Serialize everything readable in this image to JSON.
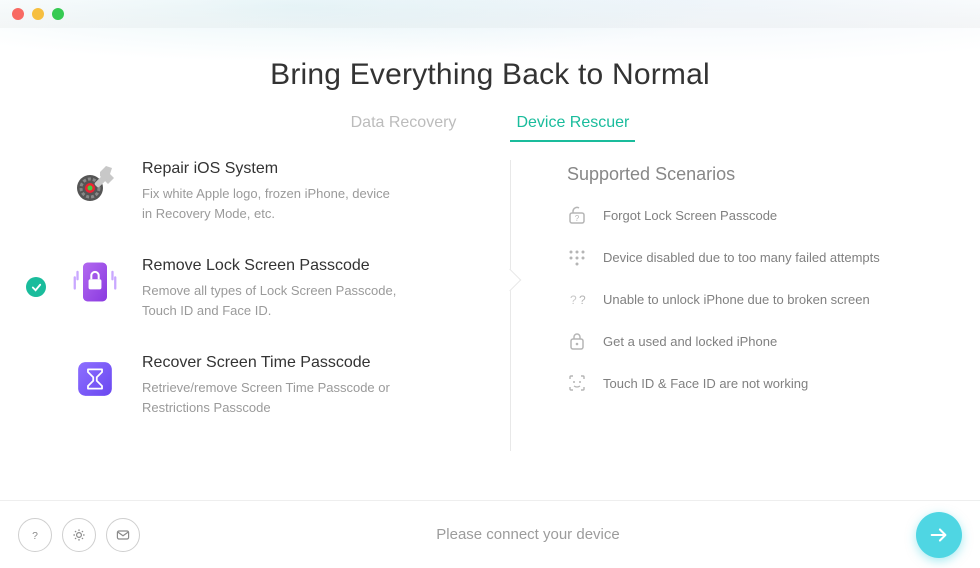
{
  "title": "Bring Everything Back to Normal",
  "tabs": {
    "data_recovery": "Data Recovery",
    "device_rescuer": "Device Rescuer"
  },
  "options": {
    "repair": {
      "title": "Repair iOS System",
      "desc": "Fix white Apple logo, frozen iPhone, device in Recovery Mode, etc."
    },
    "remove": {
      "title": "Remove Lock Screen Passcode",
      "desc": "Remove all types of Lock Screen Passcode, Touch ID and Face ID."
    },
    "recover": {
      "title": "Recover Screen Time Passcode",
      "desc": "Retrieve/remove Screen Time Passcode or Restrictions Passcode"
    }
  },
  "supported": {
    "heading": "Supported Scenarios",
    "items": [
      "Forgot Lock Screen Passcode",
      "Device disabled due to too many failed attempts",
      "Unable to unlock iPhone due to broken screen",
      "Get a used and locked iPhone",
      "Touch ID & Face ID are not working"
    ]
  },
  "footer": {
    "status": "Please connect your device"
  }
}
